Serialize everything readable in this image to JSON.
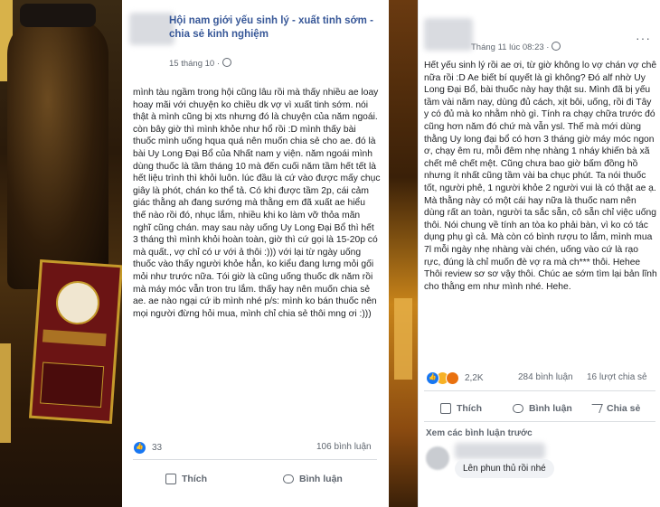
{
  "post_left": {
    "group_name": "Hội nam giới yếu sinh lý - xuất tinh sớm - chia sẻ kinh nghiệm",
    "date": "15 tháng 10 ·",
    "body": "mình tàu ngầm trong hội cũng lâu rồi mà thấy nhiều ae loay hoay mãi với chuyện ko chiều dk vợ vì xuất tinh sớm. nói thật à mình cũng bị xts nhưng đó là chuyện của năm ngoái. còn bây giờ thì mình khỏe như hổ rồi :D mình thấy bài thuốc mình uống hqua quá nên muốn chia sẻ cho ae. đó là bài Uy Long Đại Bổ của Nhất nam y viện. năm ngoái mình dùng thuốc là tầm tháng 10 mà đến cuối năm tầm hết tết là hết liệu trình thì khỏi luôn. lúc đầu là cứ vào được mấy chục giây là phót, chán ko thể tả. Có khi được tầm 2p, cái cảm giác thằng ah đang sướng mà thằng em đã xuất ae hiểu thế nào rồi đó, nhục lắm, nhiều khi ko làm vỡ thỏa mãn nghĩ cũng chán. may sau này uống Uy Long Đại Bổ thì hết 3 tháng thì mình khỏi hoàn toàn, giờ thì cứ gọi là 15-20p có mà quất., vợ chỉ có ư với ả thôi :))) với lại từ ngày uống thuốc vào thấy người khỏe hẳn, ko kiểu đang lưng mỏi gối mỏi như trước nữa. Tói giờ là cũng uống thuốc dk năm rồi mà máy móc vẫn tron tru lắm. thấy hay nên muốn chia sẻ ae. ae nào ngại cứ ib mình nhé p/s: mình ko bán thuốc nên mọi người đừng hỏi mua, mình chỉ chia sẻ thôi mng ơi :)))",
    "reactions_count": "33",
    "comments_count": "106 bình luận",
    "like_label": "Thích",
    "comment_label": "Bình luận"
  },
  "post_right": {
    "date": "Tháng 11 lúc 08:23 ·",
    "more_label": "···",
    "body": "Hết yếu sinh lý rồi ae ơi, từ giờ không lo vợ chán vợ chê nữa rồi :D Ae biết bí quyết là gì không? Đó alf nhờ Uy Long Đại Bổ, bài thuốc này hay thật su. Mình đã bị yếu tầm vài năm nay, dùng đủ cách, xịt bôi, uống, rồi đi Tây y có đủ mà ko nhằm nhò gì. Tính ra chạy chữa trước đó cũng hơn năm đó chứ mà vẫn ysl. Thế mà mới dùng thằng Uy long đại bổ có hơn 3 tháng giờ máy móc ngon ơ, chạy êm ru, mỗi đêm nhẹ nhàng 1 nháy khiến bà xã chết mê chết mệt. Cũng chưa bao giờ bấm đồng hồ nhưng ít nhất cũng tầm vài ba chục phút. Ta nói thuốc tốt, người phê, 1 người khỏe 2 người vui là có thật ae ạ. Mà thằng này có một cái hay nữa là thuốc nam nên dùng rất an toàn, người ta sắc sẵn, cô sẵn chỉ việc uống thôi. Nói chung về tính an tòa ko phải bàn, vì ko có tác dụng phụ gì cả. Mà còn có bình rượu to lắm, mình mua 7l mỗi ngày nhẹ nhàng vài chén, uống vào cứ là rạo rực, đúng là chỉ muốn đè vợ ra mà ch*** thôi. Hehee Thôi review sơ sơ vậy thôi. Chúc ae sớm tìm lại bản lĩnh cho thằng em như mình nhé. Hehe.",
    "reactions_count": "2,2K",
    "comments_count": "284 bình luận",
    "shares_count": "16 lượt chia sẻ",
    "like_label": "Thích",
    "comment_label": "Bình luận",
    "share_label": "Chia sẻ",
    "view_previous": "Xem các bình luận trước",
    "comment_text": "Lên phun thủ rồi nhé"
  }
}
